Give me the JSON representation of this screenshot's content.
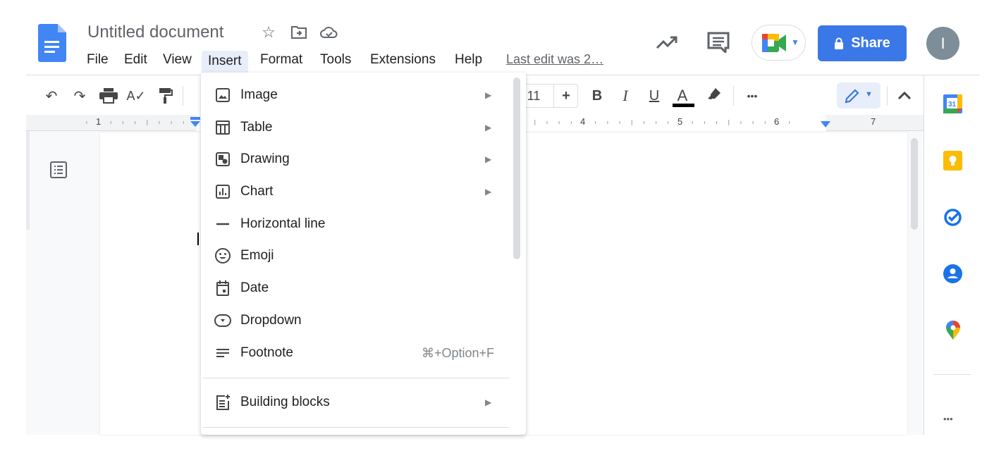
{
  "header": {
    "title": "Untitled document",
    "menus": [
      "File",
      "Edit",
      "View",
      "Insert",
      "Format",
      "Tools",
      "Extensions",
      "Help"
    ],
    "active_menu": "Insert",
    "last_edit": "Last edit was 2…",
    "share_label": "Share",
    "avatar_initial": "I",
    "icons": [
      "docs-logo",
      "star-icon",
      "move-folder-icon",
      "cloud-saved-icon",
      "activity-trend-icon",
      "comments-icon",
      "meet-icon",
      "lock-icon"
    ]
  },
  "toolbar": {
    "font_size": "11",
    "plus": "+",
    "bold": "B",
    "italic": "I",
    "underline": "U",
    "text_color": "A",
    "more": "•••",
    "text_color_value": "#000000"
  },
  "ruler": {
    "labels": [
      "1",
      "4",
      "5",
      "6",
      "7"
    ]
  },
  "insert_menu": {
    "items": [
      {
        "label": "Image",
        "icon": "image-icon",
        "submenu": true
      },
      {
        "label": "Table",
        "icon": "table-icon",
        "submenu": true
      },
      {
        "label": "Drawing",
        "icon": "drawing-icon",
        "submenu": true
      },
      {
        "label": "Chart",
        "icon": "chart-icon",
        "submenu": true
      },
      {
        "label": "Horizontal line",
        "icon": "horizontal-line-icon",
        "submenu": false
      },
      {
        "label": "Emoji",
        "icon": "emoji-icon",
        "submenu": false
      },
      {
        "label": "Date",
        "icon": "date-icon",
        "submenu": false
      },
      {
        "label": "Dropdown",
        "icon": "dropdown-icon",
        "submenu": false
      },
      {
        "label": "Footnote",
        "icon": "footnote-icon",
        "submenu": false,
        "shortcut": "⌘+Option+F"
      },
      {
        "label": "Building blocks",
        "icon": "building-blocks-icon",
        "submenu": true
      }
    ],
    "arrow": "▶"
  },
  "side_panel": {
    "calendar_day": "31",
    "icons": [
      "calendar-icon",
      "keep-icon",
      "tasks-icon",
      "contacts-icon",
      "maps-icon",
      "more-icon"
    ],
    "more": "•••"
  },
  "colors": {
    "accent": "#3b78e7",
    "menu_active": "#e8eef9"
  }
}
